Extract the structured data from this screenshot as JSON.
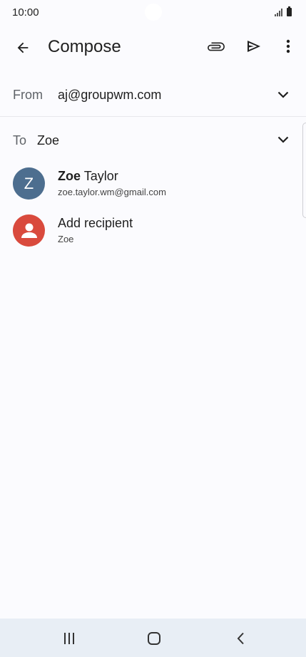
{
  "status_bar": {
    "time": "10:00",
    "icons": [
      "signal-icon",
      "battery-icon"
    ]
  },
  "app_bar": {
    "title": "Compose",
    "icons": [
      "back-arrow-icon",
      "attachment-icon",
      "send-icon",
      "more-vert-icon"
    ]
  },
  "from": {
    "label": "From",
    "value": "aj@groupwm.com"
  },
  "to": {
    "label": "To",
    "value": "Zoe"
  },
  "suggestions": [
    {
      "avatar_letter": "Z",
      "name_bold": "Zoe",
      "name_rest": " Taylor",
      "email": "zoe.taylor.wm@gmail.com",
      "avatar_color": "#4d6e8f"
    },
    {
      "title": "Add recipient",
      "subtitle": "Zoe",
      "avatar_color": "#d94a3d",
      "icon": "person-icon"
    }
  ],
  "nav_bar": {
    "icons": [
      "recent-apps-icon",
      "home-icon",
      "back-icon"
    ]
  }
}
